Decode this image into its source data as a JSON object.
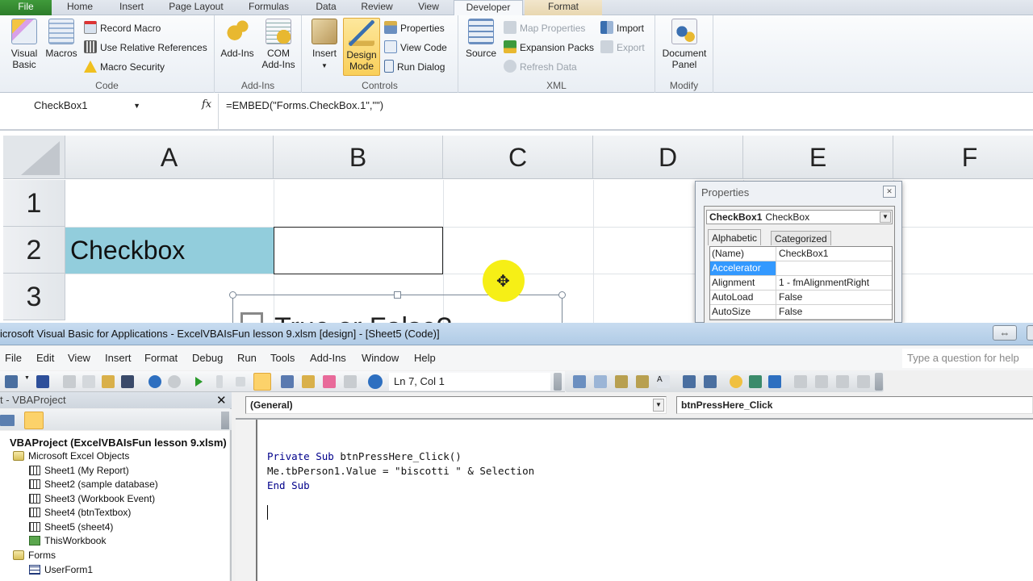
{
  "excel": {
    "tabs": [
      "File",
      "Home",
      "Insert",
      "Page Layout",
      "Formulas",
      "Data",
      "Review",
      "View",
      "Developer",
      "Format"
    ],
    "active_tab": "Developer",
    "ribbon": {
      "code_group": {
        "label": "Code",
        "visual_basic": "Visual Basic",
        "macros": "Macros",
        "record_macro": "Record Macro",
        "use_relative_references": "Use Relative References",
        "macro_security": "Macro Security"
      },
      "addins_group": {
        "label": "Add-Ins",
        "addins": "Add-Ins",
        "com_addins": "COM Add-Ins"
      },
      "controls_group": {
        "label": "Controls",
        "insert": "Insert",
        "design_mode": "Design Mode",
        "properties": "Properties",
        "view_code": "View Code",
        "run_dialog": "Run Dialog"
      },
      "xml_group": {
        "label": "XML",
        "source": "Source",
        "map_properties": "Map Properties",
        "expansion_packs": "Expansion Packs",
        "refresh_data": "Refresh Data",
        "import": "Import",
        "export": "Export"
      },
      "modify_group": {
        "label": "Modify",
        "document_panel": "Document Panel"
      }
    },
    "formula_bar": {
      "name_box": "CheckBox1",
      "fx": "fx",
      "formula": "=EMBED(\"Forms.CheckBox.1\",\"\")"
    },
    "columns": [
      "A",
      "B",
      "C",
      "D",
      "E",
      "F"
    ],
    "rows": [
      "1",
      "2",
      "3"
    ],
    "cells": {
      "A2": "Checkbox"
    },
    "checkbox_control_label": "True or False?",
    "properties_window": {
      "title": "Properties",
      "object_name": "CheckBox1",
      "object_type": "CheckBox",
      "tabs": [
        "Alphabetic",
        "Categorized"
      ],
      "rows": [
        {
          "key": "(Name)",
          "value": "CheckBox1"
        },
        {
          "key": "Accelerator",
          "value": ""
        },
        {
          "key": "Alignment",
          "value": "1 - fmAlignmentRight"
        },
        {
          "key": "AutoLoad",
          "value": "False"
        },
        {
          "key": "AutoSize",
          "value": "False"
        }
      ],
      "selected_row": "Accelerator"
    }
  },
  "vbe": {
    "title": "icrosoft Visual Basic for Applications - ExcelVBAIsFun lesson 9.xlsm [design] - [Sheet5 (Code)]",
    "menu": [
      "File",
      "Edit",
      "View",
      "Insert",
      "Format",
      "Debug",
      "Run",
      "Tools",
      "Add-Ins",
      "Window",
      "Help"
    ],
    "help_placeholder": "Type a question for help",
    "cursor_position": "Ln 7, Col 1",
    "project_explorer": {
      "title": "t - VBAProject",
      "root": "VBAProject (ExcelVBAIsFun lesson 9.xlsm)",
      "folders": [
        {
          "name": "Microsoft Excel Objects",
          "items": [
            "Sheet1 (My Report)",
            "Sheet2 (sample database)",
            "Sheet3 (Workbook Event)",
            "Sheet4 (btnTextbox)",
            "Sheet5 (sheet4)",
            "ThisWorkbook"
          ]
        },
        {
          "name": "Forms",
          "items": [
            "UserForm1"
          ]
        }
      ]
    },
    "code_window": {
      "object_combo": "(General)",
      "procedure_combo": "btnPressHere_Click",
      "lines": [
        {
          "kw1": "Private Sub",
          "rest": " btnPressHere_Click()"
        },
        {
          "kw1": "",
          "rest": "Me.tbPerson1.Value = \"biscotti \" & Selection"
        },
        {
          "kw1": "End Sub",
          "rest": ""
        }
      ]
    }
  },
  "colors": {
    "cell_fill": "#92cddc",
    "design_mode_active": "#f9cf5a",
    "selection_highlight": "#3399ff",
    "cursor_highlight": "#f6ef16",
    "file_tab": "#2d7d2a"
  }
}
